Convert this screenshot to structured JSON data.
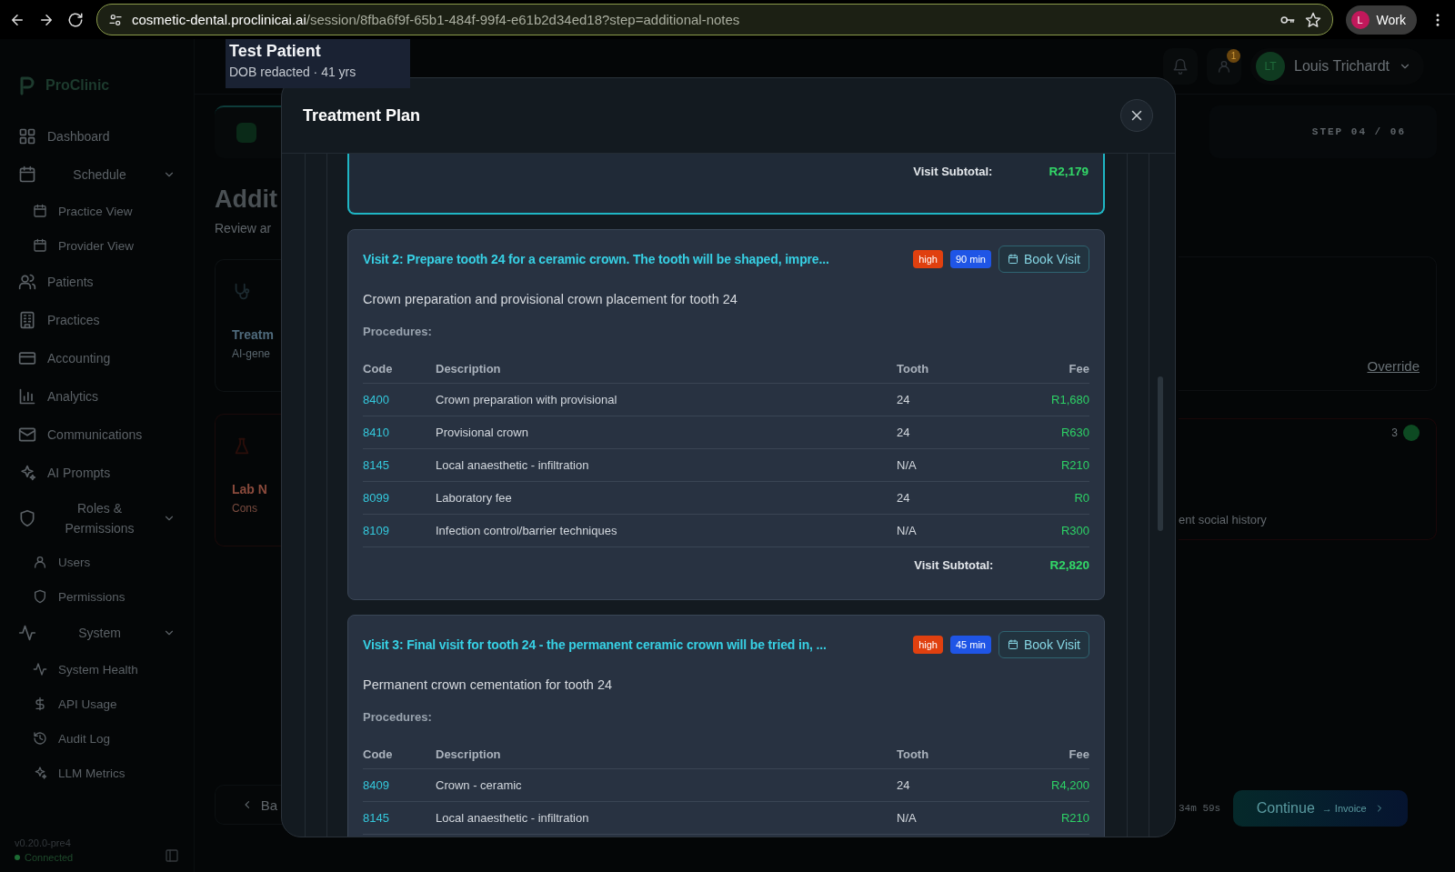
{
  "browser": {
    "url_host": "cosmetic-dental.proclinicai.ai",
    "url_path": "/session/8fba6f9f-65b1-484f-99f4-e61b2d34ed18?step=additional-notes",
    "profile": "Work",
    "profile_initial": "L"
  },
  "sidebar": {
    "brand": "ProClinic",
    "items": [
      {
        "label": "Dashboard"
      },
      {
        "label": "Schedule",
        "expanded": true,
        "children": [
          {
            "label": "Practice View"
          },
          {
            "label": "Provider View"
          }
        ]
      },
      {
        "label": "Patients"
      },
      {
        "label": "Practices"
      },
      {
        "label": "Accounting"
      },
      {
        "label": "Analytics"
      },
      {
        "label": "Communications"
      },
      {
        "label": "AI Prompts"
      },
      {
        "label": "Roles & Permissions",
        "expanded": true,
        "children": [
          {
            "label": "Users"
          },
          {
            "label": "Permissions"
          }
        ]
      },
      {
        "label": "System",
        "expanded": true,
        "children": [
          {
            "label": "System Health"
          },
          {
            "label": "API Usage"
          },
          {
            "label": "Audit Log"
          },
          {
            "label": "LLM Metrics"
          }
        ]
      }
    ],
    "version": "v0.20.0-pre4",
    "connection": "Connected"
  },
  "header": {
    "notification_count": "1",
    "user_initials": "LT",
    "user_name": "Louis Trichardt"
  },
  "background": {
    "page_title": "Addit",
    "page_subtitle": "Review ar",
    "cards": [
      {
        "kind": "treatment",
        "title": "Treatm",
        "subtitle": "AI-gene"
      },
      {
        "kind": "lab",
        "title": "Lab N",
        "subtitle": "Cons"
      }
    ],
    "back_button": "Ba",
    "step": "STEP 04 / 06",
    "override": "Override",
    "count": "3",
    "note": "ent social history",
    "timer": "34m 59s",
    "continue_label": "Continue",
    "continue_sub": "→ Invoice"
  },
  "tooltip": {
    "name": "Test Patient",
    "dob": "DOB redacted",
    "separator": "·",
    "age": "41 yrs"
  },
  "modal": {
    "title": "Treatment Plan",
    "visits": [
      {
        "highlighted": true,
        "subtotal_label": "Visit Subtotal:",
        "subtotal": "R2,179"
      },
      {
        "highlighted": false,
        "title": "Visit 2: Prepare tooth 24 for a ceramic crown. The tooth will be shaped, impre...",
        "priority": "high",
        "duration": "90 min",
        "book_label": "Book Visit",
        "description": "Crown preparation and provisional crown placement for tooth 24",
        "procedures_label": "Procedures:",
        "columns": [
          "Code",
          "Description",
          "Tooth",
          "Fee"
        ],
        "rows": [
          {
            "code": "8400",
            "description": "Crown preparation with provisional",
            "tooth": "24",
            "fee": "R1,680"
          },
          {
            "code": "8410",
            "description": "Provisional crown",
            "tooth": "24",
            "fee": "R630"
          },
          {
            "code": "8145",
            "description": "Local anaesthetic - infiltration",
            "tooth": "N/A",
            "fee": "R210"
          },
          {
            "code": "8099",
            "description": "Laboratory fee",
            "tooth": "24",
            "fee": "R0"
          },
          {
            "code": "8109",
            "description": "Infection control/barrier techniques",
            "tooth": "N/A",
            "fee": "R300"
          }
        ],
        "subtotal_label": "Visit Subtotal:",
        "subtotal": "R2,820"
      },
      {
        "highlighted": false,
        "title": "Visit 3: Final visit for tooth 24 - the permanent ceramic crown will be tried in, ...",
        "priority": "high",
        "duration": "45 min",
        "book_label": "Book Visit",
        "description": "Permanent crown cementation for tooth 24",
        "procedures_label": "Procedures:",
        "columns": [
          "Code",
          "Description",
          "Tooth",
          "Fee"
        ],
        "rows": [
          {
            "code": "8409",
            "description": "Crown - ceramic",
            "tooth": "24",
            "fee": "R4,200"
          },
          {
            "code": "8145",
            "description": "Local anaesthetic - infiltration",
            "tooth": "N/A",
            "fee": "R210"
          }
        ]
      }
    ]
  }
}
